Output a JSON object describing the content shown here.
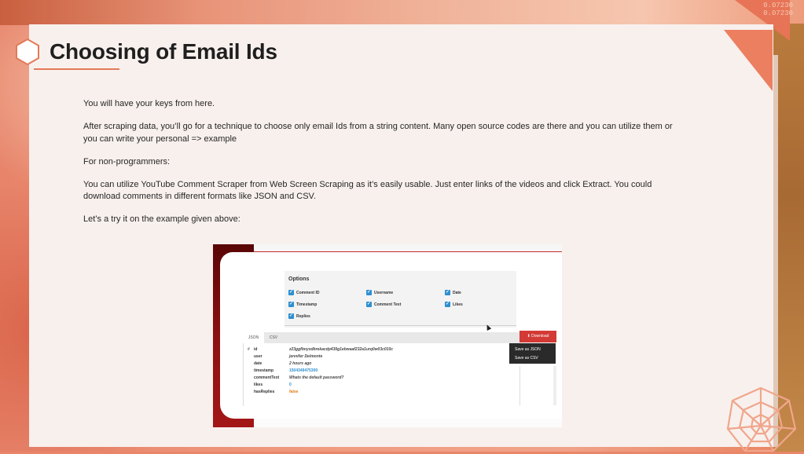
{
  "slide": {
    "title": "Choosing of Email Ids",
    "paragraphs": [
      "You will have your keys from here.",
      "After scraping data, you’ll go for a technique to choose only email Ids from a string content. Many open source codes are there and you can utilize them or you can write your personal => example",
      "For non-programmers:",
      "You can utilize YouTube Comment Scraper from Web Screen Scraping as it’s easily usable. Just enter links of the videos and click Extract. You could download comments in different formats like JSON and CSV.",
      "Let’s a try it on the example given above:"
    ],
    "corner_numbers": [
      "0.07230",
      "0.07230"
    ],
    "accent_color": "#e27a59"
  },
  "screenshot": {
    "options_title": "Options",
    "options": [
      {
        "label": "Comment ID",
        "checked": true
      },
      {
        "label": "Username",
        "checked": true
      },
      {
        "label": "Date",
        "checked": true
      },
      {
        "label": "Timestamp",
        "checked": true
      },
      {
        "label": "Comment Text",
        "checked": true
      },
      {
        "label": "Likes",
        "checked": true
      },
      {
        "label": "Replies",
        "checked": true
      }
    ],
    "tabs": [
      "JSON",
      "CSV"
    ],
    "download_label": "⬇ Download",
    "download_menu": [
      "Save as JSON",
      "Save as CSV"
    ],
    "gutter_symbol": "#",
    "json_rows": [
      {
        "key": "id",
        "value": "z23ggfbnyxdbrekacdp430g1ebwaaf232a1urq0w03c010c"
      },
      {
        "key": "user",
        "value": "jennifer Delmonte"
      },
      {
        "key": "date",
        "value": "2 hours ago"
      },
      {
        "key": "timestamp",
        "value": "1504349475300"
      },
      {
        "key": "commentText",
        "value": "Whats the default password?"
      },
      {
        "key": "likes",
        "value": "0"
      },
      {
        "key": "hasReplies",
        "value": "false"
      }
    ],
    "colors": {
      "checkbox": "#2e8fd0",
      "download_button": "#d33a35"
    }
  }
}
